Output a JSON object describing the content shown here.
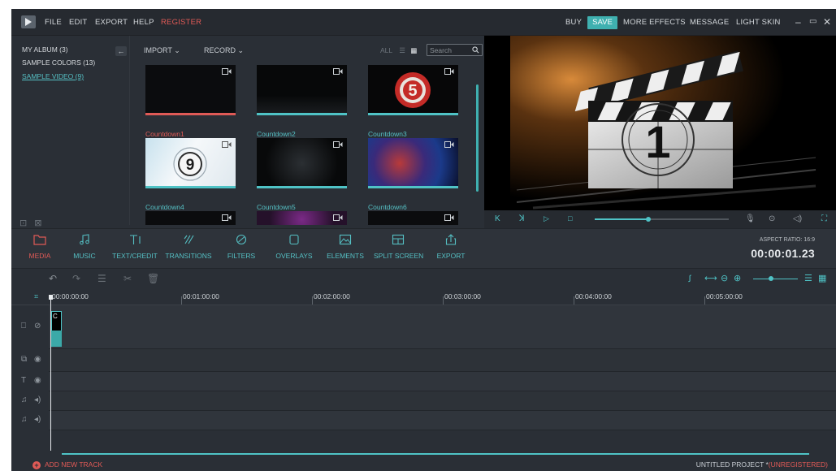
{
  "menu": {
    "file": "FILE",
    "edit": "EDIT",
    "export": "EXPORT",
    "help": "HELP",
    "register": "REGISTER"
  },
  "topright": {
    "buy": "BUY",
    "save": "SAVE",
    "more_effects": "MORE EFFECTS",
    "message": "MESSAGE",
    "light_skin": "LIGHT SKIN"
  },
  "albums": [
    {
      "label": "MY ALBUM (3)"
    },
    {
      "label": "SAMPLE COLORS (13)"
    },
    {
      "label": "SAMPLE VIDEO (9)"
    }
  ],
  "library": {
    "import": "IMPORT",
    "record": "RECORD",
    "all": "ALL",
    "search_placeholder": "Search",
    "items": [
      {
        "label": "Countdown1",
        "selected": true
      },
      {
        "label": "Countdown2"
      },
      {
        "label": "Countdown3",
        "number": "5"
      },
      {
        "label": "Countdown4",
        "number": "9"
      },
      {
        "label": "Countdown5"
      },
      {
        "label": "Countdown6"
      }
    ]
  },
  "preview": {
    "clapper_number": "1"
  },
  "tabs": [
    {
      "label": "MEDIA",
      "icon": "folder-icon"
    },
    {
      "label": "MUSIC",
      "icon": "music-icon"
    },
    {
      "label": "TEXT/CREDIT",
      "icon": "text-icon"
    },
    {
      "label": "TRANSITIONS",
      "icon": "transitions-icon"
    },
    {
      "label": "FILTERS",
      "icon": "filters-icon"
    },
    {
      "label": "OVERLAYS",
      "icon": "overlays-icon"
    },
    {
      "label": "ELEMENTS",
      "icon": "elements-icon"
    },
    {
      "label": "SPLIT SCREEN",
      "icon": "split-screen-icon"
    },
    {
      "label": "EXPORT",
      "icon": "export-icon"
    }
  ],
  "aspect_ratio": "ASPECT RATIO: 16:9",
  "timecode": "00:00:01.23",
  "ruler": [
    "00:00:00:00",
    "00:01:00:00",
    "00:02:00:00",
    "00:03:00:00",
    "00:04:00:00",
    "00:05:00:00"
  ],
  "clip_label": "C",
  "status": {
    "add_track": "ADD NEW TRACK",
    "project": "UNTITLED PROJECT *",
    "unregistered": "(UNREGISTERED)"
  },
  "colors": {
    "accent": "#4fc3c6",
    "brand_red": "#e05a56",
    "background": "#2a2f36",
    "save_button": "#3fb0b0"
  }
}
